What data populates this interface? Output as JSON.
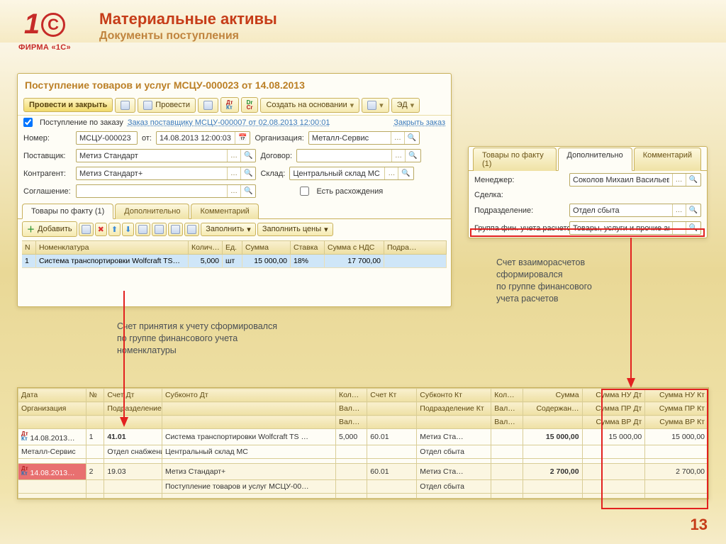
{
  "logo_text": "ФИРМА «1С»",
  "title": "Материальные активы",
  "subtitle": "Документы поступления",
  "page_number": "13",
  "panel1": {
    "title": "Поступление товаров и услуг МСЦУ-000023 от 14.08.2013",
    "btn_post_close": "Провести и закрыть",
    "btn_post": "Провести",
    "btn_create_based": "Создать на основании",
    "btn_ed": "ЭД",
    "cb_by_order": "Поступление по заказу",
    "order_link": "Заказ поставщику МСЦУ-000007 от 02.08.2013 12:00:01",
    "close_order": "Закрыть заказ",
    "lbl_number": "Номер:",
    "val_number": "МСЦУ-000023",
    "lbl_from": "от:",
    "val_from": "14.08.2013 12:00:03",
    "lbl_org": "Организация:",
    "val_org": "Металл-Сервис",
    "lbl_supplier": "Поставщик:",
    "val_supplier": "Метиз Стандарт",
    "lbl_contract": "Договор:",
    "val_contract": "",
    "lbl_counterparty": "Контрагент:",
    "val_counterparty": "Метиз Стандарт+",
    "lbl_warehouse": "Склад:",
    "val_warehouse": "Центральный склад МС",
    "lbl_agreement": "Соглашение:",
    "cb_discrep": "Есть расхождения",
    "tabs": [
      "Товары по факту (1)",
      "Дополнительно",
      "Комментарий"
    ],
    "btn_add": "Добавить",
    "btn_fill": "Заполнить",
    "btn_fill_prices": "Заполнить цены",
    "grid_cols": [
      "N",
      "Номенклатура",
      "Колич…",
      "Ед.",
      "Сумма",
      "Ставка",
      "Сумма с НДС",
      "Подра…"
    ],
    "grid_row": [
      "1",
      "Система транспортировки Wolfcraft TS…",
      "5,000",
      "шт",
      "15 000,00",
      "18%",
      "17 700,00",
      ""
    ]
  },
  "panel2": {
    "tabs": [
      "Товары по факту (1)",
      "Дополнительно",
      "Комментарий"
    ],
    "lbl_manager": "Менеджер:",
    "val_manager": "Соколов Михаил Васильевич",
    "lbl_deal": "Сделка:",
    "val_deal": "",
    "lbl_division": "Подразделение:",
    "val_division": "Отдел сбыта",
    "lbl_fingroup": "Группа фин. учета расчетов:",
    "val_fingroup": "Товары, услуги и прочие активы"
  },
  "annot1": "Счет принятия к учету сформировался\nпо группе финансового учета\nноменклатуры",
  "annot2": "Счет взаиморасчетов\nсформировался\nпо группе финансового\nучета расчетов",
  "ledger": {
    "head_r1": [
      "Дата",
      "№",
      "Счет Дт",
      "Субконто Дт",
      "Кол…",
      "Счет Кт",
      "Субконто Кт",
      "Кол…",
      "Сумма",
      "Сумма НУ Дт",
      "Сумма НУ Кт"
    ],
    "head_r2": [
      "Организация",
      "",
      "Подразделение Дт",
      "",
      "Вал…",
      "",
      "Подразделение Кт",
      "Вал…",
      "Содержан…",
      "Сумма ПР Дт",
      "Сумма ПР Кт"
    ],
    "head_r3": [
      "",
      "",
      "",
      "",
      "Вал…",
      "",
      "",
      "Вал…",
      "",
      "Сумма ВР Дт",
      "Сумма ВР Кт"
    ],
    "rows": [
      {
        "r1": [
          "14.08.2013…",
          "1",
          "41.01",
          "Система транспортировки Wolfcraft TS …",
          "5,000",
          "60.01",
          "Метиз Ста…",
          "",
          "15 000,00",
          "15 000,00",
          "15 000,00"
        ],
        "r2": [
          "Металл-Сервис",
          "",
          "Отдел снабжения",
          "Центральный склад МС",
          "",
          "",
          "Отдел сбыта",
          "",
          "",
          "",
          ""
        ],
        "r3": [
          "",
          "",
          "",
          "",
          "",
          "",
          "",
          "",
          "",
          "",
          ""
        ]
      },
      {
        "r1": [
          "14.08.2013…",
          "2",
          "19.03",
          "Метиз Стандарт+",
          "",
          "60.01",
          "Метиз Ста…",
          "",
          "2 700,00",
          "",
          "2 700,00"
        ],
        "r2": [
          "",
          "",
          "",
          "Поступление товаров и услуг МСЦУ-00…",
          "",
          "",
          "Отдел сбыта",
          "",
          "",
          "",
          ""
        ],
        "r3": [
          "",
          "",
          "",
          "",
          "",
          "",
          "",
          "",
          "",
          "",
          ""
        ],
        "redmark": true
      }
    ]
  }
}
